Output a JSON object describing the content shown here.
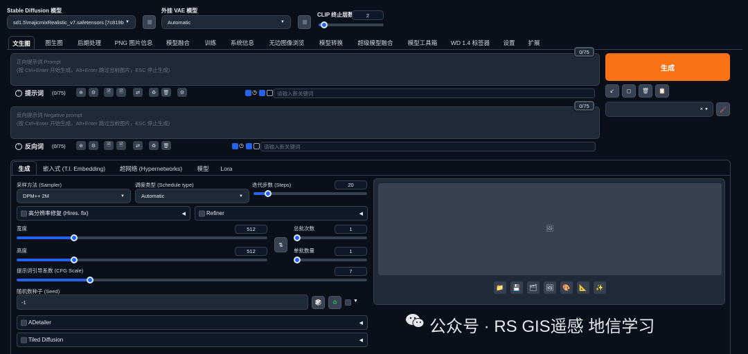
{
  "header": {
    "model_label": "Stable Diffusion 模型",
    "model_value": "sd1.5\\majicmixRealistic_v7.safetensors [7c819b",
    "vae_label": "外挂 VAE 模型",
    "vae_value": "Automatic",
    "clip_label": "CLIP 终止层数",
    "clip_value": "2",
    "clip_fraction": 0.08
  },
  "tabs": [
    "文生图",
    "图生图",
    "后期处理",
    "PNG 图片信息",
    "模型融合",
    "训练",
    "系统信息",
    "无边图像浏览",
    "模型转换",
    "超级模型融合",
    "模型工具箱",
    "WD 1.4 标签器",
    "设置",
    "扩展"
  ],
  "prompt": {
    "placeholder_line1": "正向提示词 Prompt",
    "placeholder_line2": "(按 Ctrl+Enter 开始生成，Alt+Enter 跳过当前图片，ESC 停止生成)",
    "counter": "0/75",
    "title": "提示词",
    "count": "(0/75)",
    "keyword_placeholder": "请输入新关键词"
  },
  "negative": {
    "placeholder_line1": "反向提示词 Negative prompt",
    "placeholder_line2": "(按 Ctrl+Enter 开始生成，Alt+Enter 跳过当前图片，ESC 停止生成)",
    "counter": "0/75",
    "title": "反向词",
    "count": "(0/75)",
    "keyword_placeholder": "请输入新关键词"
  },
  "generate": {
    "label": "生成",
    "color": "#f97316"
  },
  "subtabs": [
    "生成",
    "嵌入式 (T.I. Embedding)",
    "超网络 (Hypernetworks)",
    "模型",
    "Lora"
  ],
  "params": {
    "sampler_label": "采样方法 (Sampler)",
    "sampler_value": "DPM++ 2M",
    "schedule_label": "调度类型 (Schedule type)",
    "schedule_value": "Automatic",
    "steps_label": "迭代步数 (Steps)",
    "steps_value": "20",
    "steps_fraction": 0.13,
    "hires_label": "高分辨率修复 (Hires. fix)",
    "refiner_label": "Refiner",
    "width_label": "宽度",
    "width_value": "512",
    "width_fraction": 0.23,
    "height_label": "高度",
    "height_value": "512",
    "height_fraction": 0.23,
    "batch_count_label": "总批次数",
    "batch_count_value": "1",
    "batch_count_fraction": 0.0,
    "batch_size_label": "单批数量",
    "batch_size_value": "1",
    "batch_size_fraction": 0.0,
    "cfg_label": "提示词引导系数 (CFG Scale)",
    "cfg_value": "7",
    "cfg_fraction": 0.21,
    "seed_label": "随机数种子 (Seed)",
    "seed_value": "-1"
  },
  "extensions": [
    "ADetailer",
    "Tiled Diffusion"
  ],
  "watermark": "公众号 · RS GIS遥感 地信学习"
}
